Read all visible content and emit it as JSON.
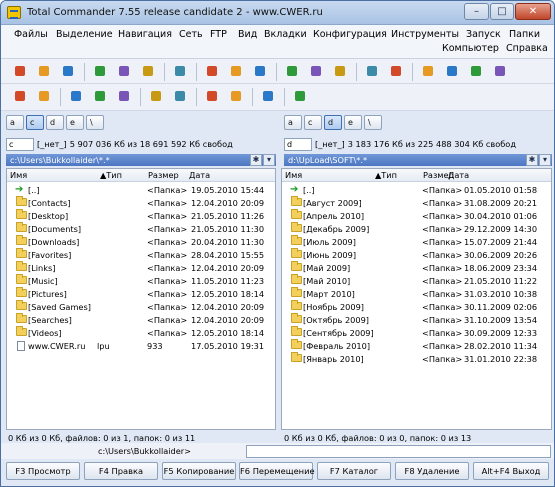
{
  "window": {
    "title": "Total Commander 7.55 release candidate 2 - www.CWER.ru",
    "minimize": "–",
    "maximize": "□",
    "close": "✕"
  },
  "menu": {
    "row1": [
      "Файлы",
      "Выделение",
      "Навигация",
      "Сеть",
      "FTP",
      "Вид",
      "Вкладки",
      "Конфигурация",
      "Инструменты",
      "Запуск",
      "Папки"
    ],
    "row2": [
      "Компьютер",
      "Справка"
    ]
  },
  "toolbar1_icons": [
    "gear-red-icon",
    "gear-icon",
    "gear-icon",
    "refresh-icon",
    "arrow-left-icon",
    "arrow-right-icon",
    "network-icon",
    "notepad-icon",
    "pack-icon",
    "unpack-icon",
    "sparkle-icon",
    "sort-icon",
    "checklist-icon",
    "browser-icon",
    "search-icon",
    "copy-names-icon",
    "compare-icon",
    "folder-icon",
    "help-icon"
  ],
  "toolbar2_icons": [
    "edit-icon",
    "cut-icon",
    "note-icon",
    "list-icon",
    "console-icon",
    "tools-icon",
    "user-icon",
    "window-icon",
    "terminal-icon",
    "disk-icon",
    "brush-icon"
  ],
  "colors": {
    "accent": "#4b76c0",
    "folder": "#f3cf5b",
    "up_arrow": "#1a9a1a",
    "title_bar": "#b9d0ec"
  },
  "left": {
    "drives": [
      "a",
      "c",
      "d",
      "e",
      "\\"
    ],
    "active_drive": 1,
    "drive_select": "c",
    "label": "[_нет_]",
    "info": "5 907 036 Кб из 18 691 592 Кб свобод",
    "path": "c:\\Users\\Bukkollaider\\*.*",
    "headers": {
      "name": "Имя",
      "ext": "Тип",
      "size": "Размер",
      "date": "Дата"
    },
    "rows": [
      {
        "name": "[..]",
        "ext": "",
        "size": "<Папка>",
        "date": "19.05.2010 15:44",
        "icon": "up"
      },
      {
        "name": "[Contacts]",
        "ext": "",
        "size": "<Папка>",
        "date": "12.04.2010 20:09",
        "icon": "folder"
      },
      {
        "name": "[Desktop]",
        "ext": "",
        "size": "<Папка>",
        "date": "21.05.2010 11:26",
        "icon": "folder"
      },
      {
        "name": "[Documents]",
        "ext": "",
        "size": "<Папка>",
        "date": "21.05.2010 11:30",
        "icon": "folder"
      },
      {
        "name": "[Downloads]",
        "ext": "",
        "size": "<Папка>",
        "date": "20.04.2010 11:30",
        "icon": "folder"
      },
      {
        "name": "[Favorites]",
        "ext": "",
        "size": "<Папка>",
        "date": "28.04.2010 15:55",
        "icon": "folder"
      },
      {
        "name": "[Links]",
        "ext": "",
        "size": "<Папка>",
        "date": "12.04.2010 20:09",
        "icon": "folder"
      },
      {
        "name": "[Music]",
        "ext": "",
        "size": "<Папка>",
        "date": "11.05.2010 11:23",
        "icon": "folder"
      },
      {
        "name": "[Pictures]",
        "ext": "",
        "size": "<Папка>",
        "date": "12.05.2010 18:14",
        "icon": "folder"
      },
      {
        "name": "[Saved Games]",
        "ext": "",
        "size": "<Папка>",
        "date": "12.04.2010 20:09",
        "icon": "folder"
      },
      {
        "name": "[Searches]",
        "ext": "",
        "size": "<Папка>",
        "date": "12.04.2010 20:09",
        "icon": "folder"
      },
      {
        "name": "[Videos]",
        "ext": "",
        "size": "<Папка>",
        "date": "12.05.2010 18:14",
        "icon": "folder"
      },
      {
        "name": "www.CWER.ru",
        "ext": "lpu",
        "size": "933",
        "date": "17.05.2010 19:31",
        "icon": "file"
      }
    ],
    "status": "0 Кб из 0 Кб, файлов: 0 из 1, папок: 0 из 11"
  },
  "right": {
    "drives": [
      "a",
      "c",
      "d",
      "e",
      "\\"
    ],
    "active_drive": 2,
    "drive_select": "d",
    "label": "[_нет_]",
    "info": "3 183 176 Кб из 225 488 304 Кб свобод",
    "path": "d:\\UpLoad\\SOFT\\*.*",
    "headers": {
      "name": "Имя",
      "ext": "Тип",
      "size": "Размер",
      "date": "Дата"
    },
    "rows": [
      {
        "name": "[..]",
        "ext": "",
        "size": "<Папка>",
        "date": "01.05.2010 01:58",
        "icon": "up"
      },
      {
        "name": "[Август 2009]",
        "ext": "",
        "size": "<Папка>",
        "date": "31.08.2009 20:21",
        "icon": "folder"
      },
      {
        "name": "[Апрель 2010]",
        "ext": "",
        "size": "<Папка>",
        "date": "30.04.2010 01:06",
        "icon": "folder"
      },
      {
        "name": "[Декабрь 2009]",
        "ext": "",
        "size": "<Папка>",
        "date": "29.12.2009 14:30",
        "icon": "folder"
      },
      {
        "name": "[Июль 2009]",
        "ext": "",
        "size": "<Папка>",
        "date": "15.07.2009 21:44",
        "icon": "folder"
      },
      {
        "name": "[Июнь 2009]",
        "ext": "",
        "size": "<Папка>",
        "date": "30.06.2009 20:26",
        "icon": "folder"
      },
      {
        "name": "[Май 2009]",
        "ext": "",
        "size": "<Папка>",
        "date": "18.06.2009 23:34",
        "icon": "folder"
      },
      {
        "name": "[Май 2010]",
        "ext": "",
        "size": "<Папка>",
        "date": "21.05.2010 11:22",
        "icon": "folder"
      },
      {
        "name": "[Март 2010]",
        "ext": "",
        "size": "<Папка>",
        "date": "31.03.2010 10:38",
        "icon": "folder"
      },
      {
        "name": "[Ноябрь 2009]",
        "ext": "",
        "size": "<Папка>",
        "date": "30.11.2009 02:06",
        "icon": "folder"
      },
      {
        "name": "[Октябрь 2009]",
        "ext": "",
        "size": "<Папка>",
        "date": "31.10.2009 13:54",
        "icon": "folder"
      },
      {
        "name": "[Сентябрь 2009]",
        "ext": "",
        "size": "<Папка>",
        "date": "30.09.2009 12:33",
        "icon": "folder"
      },
      {
        "name": "[Февраль 2010]",
        "ext": "",
        "size": "<Папка>",
        "date": "28.02.2010 11:34",
        "icon": "folder"
      },
      {
        "name": "[Январь 2010]",
        "ext": "",
        "size": "<Папка>",
        "date": "31.01.2010 22:38",
        "icon": "folder"
      }
    ],
    "status": "0 Кб из 0 Кб, файлов: 0 из 0, папок: 0 из 13"
  },
  "command_line": {
    "prompt": "c:\\Users\\Bukkollaider>",
    "value": ""
  },
  "fkeys": [
    "F3 Просмотр",
    "F4 Правка",
    "F5 Копирование",
    "F6 Перемещение",
    "F7 Каталог",
    "F8 Удаление",
    "Alt+F4 Выход"
  ]
}
